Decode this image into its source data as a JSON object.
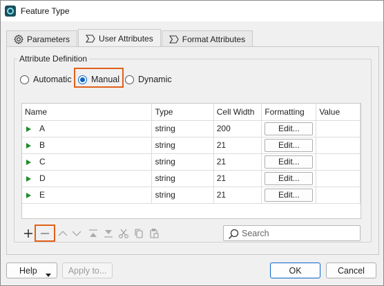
{
  "window": {
    "title": "Feature Type"
  },
  "tabs": [
    {
      "label": "Parameters",
      "icon": "gear-icon"
    },
    {
      "label": "User Attributes",
      "icon": "sigma-icon",
      "active": true
    },
    {
      "label": "Format Attributes",
      "icon": "sigma-icon"
    }
  ],
  "attribute_definition": {
    "label": "Attribute Definition",
    "options": [
      "Automatic",
      "Manual",
      "Dynamic"
    ],
    "selected": "Manual"
  },
  "table": {
    "columns": [
      "Name",
      "Type",
      "Cell Width",
      "Formatting",
      "Value"
    ],
    "rows": [
      {
        "name": "A",
        "type": "string",
        "width": "200",
        "formatting": "Edit...",
        "value": ""
      },
      {
        "name": "B",
        "type": "string",
        "width": "21",
        "formatting": "Edit...",
        "value": ""
      },
      {
        "name": "C",
        "type": "string",
        "width": "21",
        "formatting": "Edit...",
        "value": ""
      },
      {
        "name": "D",
        "type": "string",
        "width": "21",
        "formatting": "Edit...",
        "value": ""
      },
      {
        "name": "E",
        "type": "string",
        "width": "21",
        "formatting": "Edit...",
        "value": ""
      }
    ]
  },
  "search": {
    "placeholder": "Search",
    "value": ""
  },
  "footer": {
    "help_label": "Help",
    "apply_label": "Apply to...",
    "ok_label": "OK",
    "cancel_label": "Cancel"
  },
  "colors": {
    "accent": "#0a64c8",
    "highlight": "#e06019",
    "row_arrow": "#1e8c2a"
  }
}
